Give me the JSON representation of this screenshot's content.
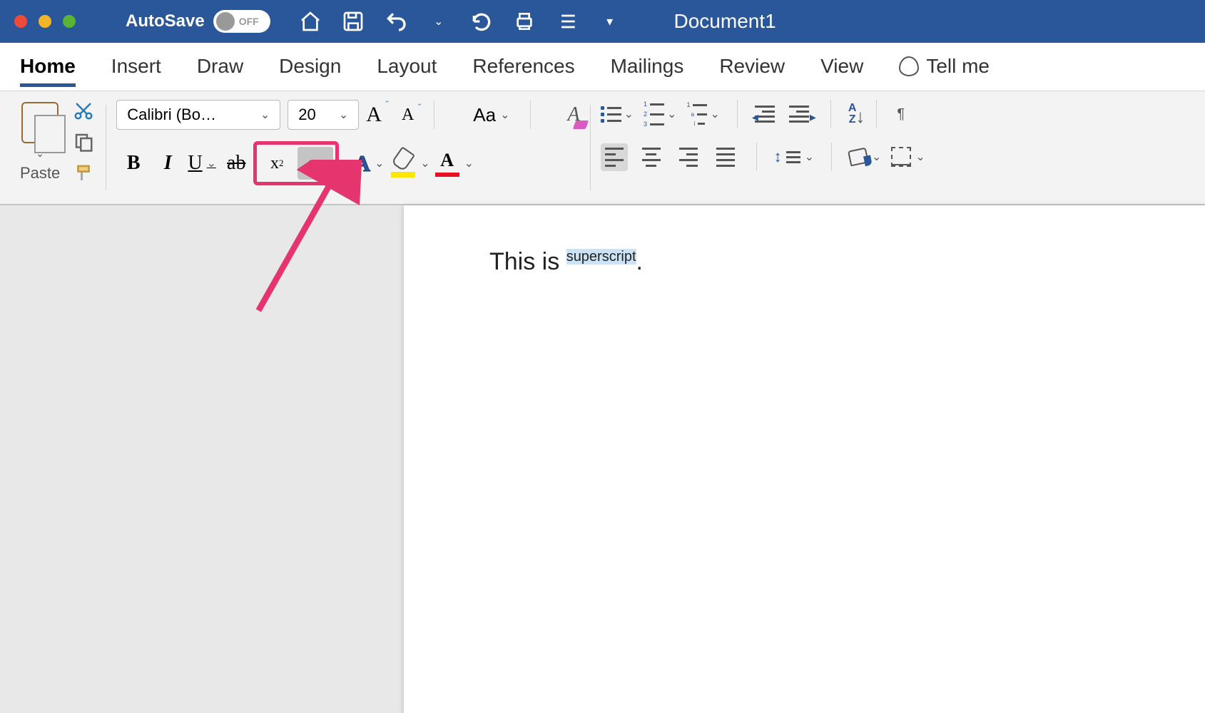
{
  "titlebar": {
    "autosave_label": "AutoSave",
    "autosave_state": "OFF",
    "document_title": "Document1"
  },
  "tabs": [
    "Home",
    "Insert",
    "Draw",
    "Design",
    "Layout",
    "References",
    "Mailings",
    "Review",
    "View"
  ],
  "active_tab": "Home",
  "tellme": "Tell me",
  "ribbon": {
    "paste_label": "Paste",
    "font_name": "Calibri (Bo…",
    "font_size": "20",
    "subscript_symbol": "x",
    "superscript_symbol": "x"
  },
  "document": {
    "text_prefix": "This is ",
    "selected_super": "superscript",
    "text_suffix": "."
  }
}
